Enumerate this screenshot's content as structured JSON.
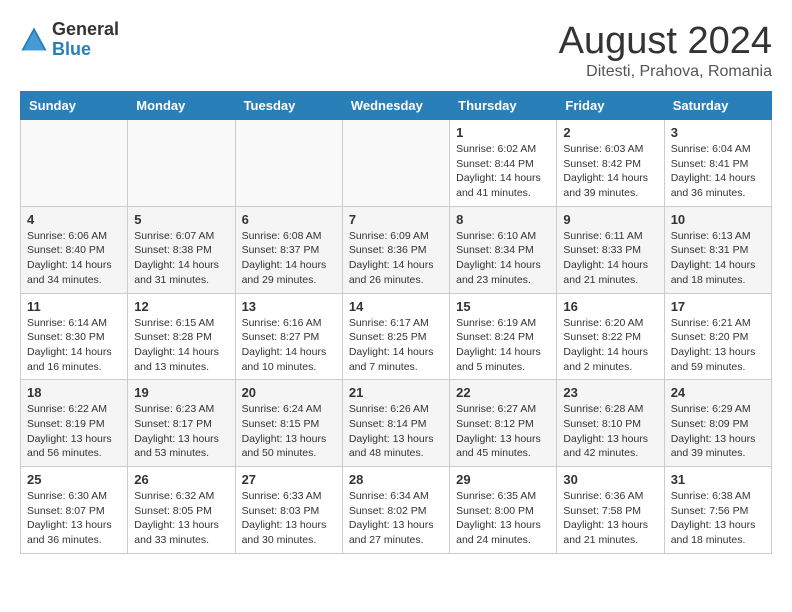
{
  "logo": {
    "general": "General",
    "blue": "Blue"
  },
  "title": "August 2024",
  "location": "Ditesti, Prahova, Romania",
  "days_header": [
    "Sunday",
    "Monday",
    "Tuesday",
    "Wednesday",
    "Thursday",
    "Friday",
    "Saturday"
  ],
  "weeks": [
    [
      {
        "day": "",
        "info": ""
      },
      {
        "day": "",
        "info": ""
      },
      {
        "day": "",
        "info": ""
      },
      {
        "day": "",
        "info": ""
      },
      {
        "day": "1",
        "sunrise": "6:02 AM",
        "sunset": "8:44 PM",
        "daylight": "14 hours and 41 minutes."
      },
      {
        "day": "2",
        "sunrise": "6:03 AM",
        "sunset": "8:42 PM",
        "daylight": "14 hours and 39 minutes."
      },
      {
        "day": "3",
        "sunrise": "6:04 AM",
        "sunset": "8:41 PM",
        "daylight": "14 hours and 36 minutes."
      }
    ],
    [
      {
        "day": "4",
        "sunrise": "6:06 AM",
        "sunset": "8:40 PM",
        "daylight": "14 hours and 34 minutes."
      },
      {
        "day": "5",
        "sunrise": "6:07 AM",
        "sunset": "8:38 PM",
        "daylight": "14 hours and 31 minutes."
      },
      {
        "day": "6",
        "sunrise": "6:08 AM",
        "sunset": "8:37 PM",
        "daylight": "14 hours and 29 minutes."
      },
      {
        "day": "7",
        "sunrise": "6:09 AM",
        "sunset": "8:36 PM",
        "daylight": "14 hours and 26 minutes."
      },
      {
        "day": "8",
        "sunrise": "6:10 AM",
        "sunset": "8:34 PM",
        "daylight": "14 hours and 23 minutes."
      },
      {
        "day": "9",
        "sunrise": "6:11 AM",
        "sunset": "8:33 PM",
        "daylight": "14 hours and 21 minutes."
      },
      {
        "day": "10",
        "sunrise": "6:13 AM",
        "sunset": "8:31 PM",
        "daylight": "14 hours and 18 minutes."
      }
    ],
    [
      {
        "day": "11",
        "sunrise": "6:14 AM",
        "sunset": "8:30 PM",
        "daylight": "14 hours and 16 minutes."
      },
      {
        "day": "12",
        "sunrise": "6:15 AM",
        "sunset": "8:28 PM",
        "daylight": "14 hours and 13 minutes."
      },
      {
        "day": "13",
        "sunrise": "6:16 AM",
        "sunset": "8:27 PM",
        "daylight": "14 hours and 10 minutes."
      },
      {
        "day": "14",
        "sunrise": "6:17 AM",
        "sunset": "8:25 PM",
        "daylight": "14 hours and 7 minutes."
      },
      {
        "day": "15",
        "sunrise": "6:19 AM",
        "sunset": "8:24 PM",
        "daylight": "14 hours and 5 minutes."
      },
      {
        "day": "16",
        "sunrise": "6:20 AM",
        "sunset": "8:22 PM",
        "daylight": "14 hours and 2 minutes."
      },
      {
        "day": "17",
        "sunrise": "6:21 AM",
        "sunset": "8:20 PM",
        "daylight": "13 hours and 59 minutes."
      }
    ],
    [
      {
        "day": "18",
        "sunrise": "6:22 AM",
        "sunset": "8:19 PM",
        "daylight": "13 hours and 56 minutes."
      },
      {
        "day": "19",
        "sunrise": "6:23 AM",
        "sunset": "8:17 PM",
        "daylight": "13 hours and 53 minutes."
      },
      {
        "day": "20",
        "sunrise": "6:24 AM",
        "sunset": "8:15 PM",
        "daylight": "13 hours and 50 minutes."
      },
      {
        "day": "21",
        "sunrise": "6:26 AM",
        "sunset": "8:14 PM",
        "daylight": "13 hours and 48 minutes."
      },
      {
        "day": "22",
        "sunrise": "6:27 AM",
        "sunset": "8:12 PM",
        "daylight": "13 hours and 45 minutes."
      },
      {
        "day": "23",
        "sunrise": "6:28 AM",
        "sunset": "8:10 PM",
        "daylight": "13 hours and 42 minutes."
      },
      {
        "day": "24",
        "sunrise": "6:29 AM",
        "sunset": "8:09 PM",
        "daylight": "13 hours and 39 minutes."
      }
    ],
    [
      {
        "day": "25",
        "sunrise": "6:30 AM",
        "sunset": "8:07 PM",
        "daylight": "13 hours and 36 minutes."
      },
      {
        "day": "26",
        "sunrise": "6:32 AM",
        "sunset": "8:05 PM",
        "daylight": "13 hours and 33 minutes."
      },
      {
        "day": "27",
        "sunrise": "6:33 AM",
        "sunset": "8:03 PM",
        "daylight": "13 hours and 30 minutes."
      },
      {
        "day": "28",
        "sunrise": "6:34 AM",
        "sunset": "8:02 PM",
        "daylight": "13 hours and 27 minutes."
      },
      {
        "day": "29",
        "sunrise": "6:35 AM",
        "sunset": "8:00 PM",
        "daylight": "13 hours and 24 minutes."
      },
      {
        "day": "30",
        "sunrise": "6:36 AM",
        "sunset": "7:58 PM",
        "daylight": "13 hours and 21 minutes."
      },
      {
        "day": "31",
        "sunrise": "6:38 AM",
        "sunset": "7:56 PM",
        "daylight": "13 hours and 18 minutes."
      }
    ]
  ],
  "labels": {
    "sunrise": "Sunrise:",
    "sunset": "Sunset:",
    "daylight": "Daylight:"
  }
}
